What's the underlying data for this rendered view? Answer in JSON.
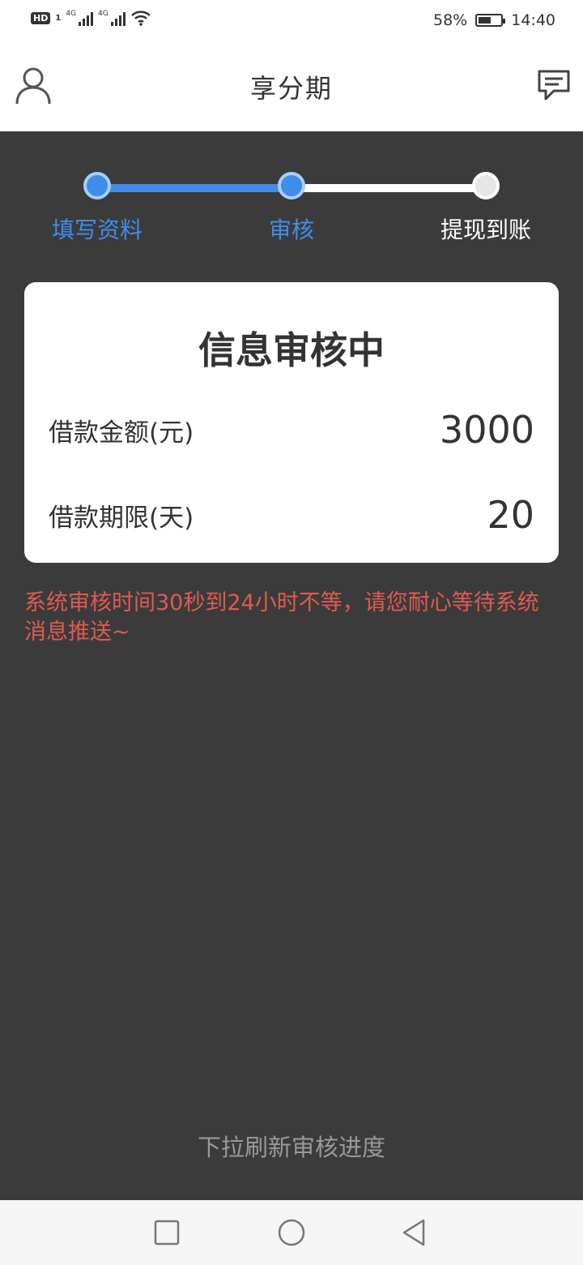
{
  "status_bar": {
    "hd": "HD",
    "sim1": "1",
    "net1": "4G",
    "net2": "4G",
    "battery_percent": "58%",
    "battery_level": 0.58,
    "time": "14:40"
  },
  "header": {
    "title": "享分期",
    "left_icon": "user-icon",
    "right_icon": "message-icon"
  },
  "steps": {
    "current": 2,
    "items": [
      {
        "label": "填写资料",
        "state": "active"
      },
      {
        "label": "审核",
        "state": "active"
      },
      {
        "label": "提现到账",
        "state": "inactive"
      }
    ],
    "colors": {
      "active": "#3f8de9",
      "inactive": "#ffffff"
    }
  },
  "card": {
    "title": "信息审核中",
    "amount_label": "借款金额(元)",
    "amount_value": "3000",
    "term_label": "借款期限(天)",
    "term_value": "20"
  },
  "notice": "系统审核时间30秒到24小时不等，请您耐心等待系统消息推送~",
  "refresh_hint": "下拉刷新审核进度",
  "nav": {
    "items": [
      "recent-apps-icon",
      "home-icon",
      "back-icon"
    ]
  },
  "colors": {
    "background": "#3b3b3c",
    "accent": "#3f8de9",
    "warning_text": "#e05a4f"
  }
}
